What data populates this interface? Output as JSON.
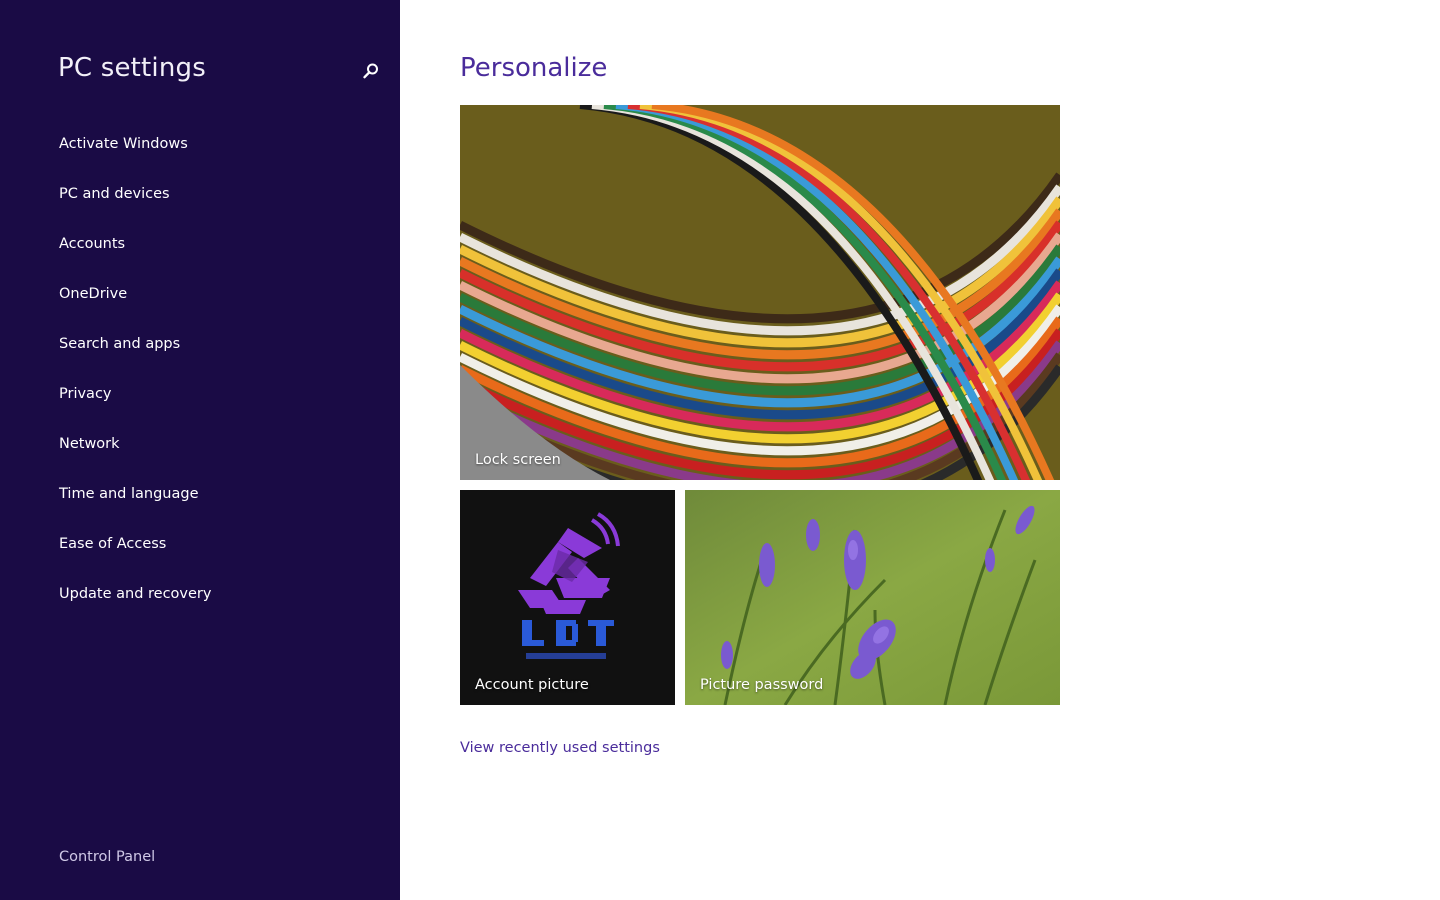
{
  "sidebar": {
    "title": "PC settings",
    "search_icon": "search-icon",
    "items": [
      {
        "label": "Activate Windows"
      },
      {
        "label": "PC and devices"
      },
      {
        "label": "Accounts"
      },
      {
        "label": "OneDrive"
      },
      {
        "label": "Search and apps"
      },
      {
        "label": "Privacy"
      },
      {
        "label": "Network"
      },
      {
        "label": "Time and language"
      },
      {
        "label": "Ease of Access"
      },
      {
        "label": "Update and recovery"
      }
    ],
    "footer_link": "Control Panel"
  },
  "main": {
    "title": "Personalize",
    "tiles": {
      "lock_screen": {
        "label": "Lock screen"
      },
      "account_picture": {
        "label": "Account picture"
      },
      "picture_password": {
        "label": "Picture password"
      }
    },
    "recent_link": "View recently used settings"
  },
  "colors": {
    "sidebar_bg": "#1a0b45",
    "accent": "#4a2c9b",
    "main_bg": "#ffffff"
  }
}
